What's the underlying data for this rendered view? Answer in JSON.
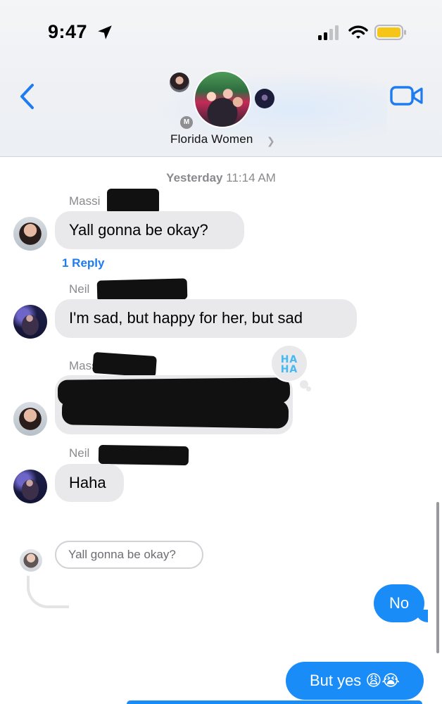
{
  "status_bar": {
    "time": "9:47"
  },
  "header": {
    "group_name": "Florida Women",
    "avatar_initial": "M"
  },
  "conversation": {
    "timestamp_day": "Yesterday",
    "timestamp_time": "11:14 AM",
    "messages": [
      {
        "sender": "Massi",
        "text": "Yall gonna be okay?",
        "reply_count": "1 Reply"
      },
      {
        "sender": "Neil",
        "text": "I'm sad, but happy for her, but sad"
      },
      {
        "sender": "Massi",
        "text": "",
        "reaction": "HA HA"
      },
      {
        "sender": "Neil",
        "text": "Haha"
      }
    ],
    "reply_thread": {
      "quoted_text": "Yall gonna be okay?",
      "outgoing": [
        {
          "text": "No"
        },
        {
          "text": "But yes 😩😭"
        }
      ]
    }
  }
}
